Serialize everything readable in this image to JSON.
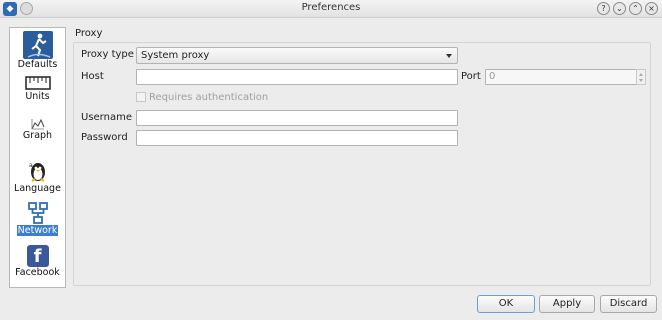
{
  "window": {
    "title": "Preferences",
    "controls": [
      "help-icon",
      "minimize-icon",
      "maximize-icon",
      "close-icon"
    ]
  },
  "sidebar": {
    "items": [
      {
        "label": "Defaults",
        "icon": "defaults-icon",
        "selected": false
      },
      {
        "label": "Units",
        "icon": "ruler-icon",
        "selected": false
      },
      {
        "label": "Graph",
        "icon": "graph-icon",
        "selected": false
      },
      {
        "label": "Language",
        "icon": "language-icon",
        "selected": false
      },
      {
        "label": "Network",
        "icon": "network-icon",
        "selected": true
      },
      {
        "label": "Facebook",
        "icon": "facebook-icon",
        "selected": false
      }
    ]
  },
  "proxy": {
    "section_title": "Proxy",
    "proxy_type_label": "Proxy type",
    "proxy_type_value": "System proxy",
    "host_label": "Host",
    "host_value": "",
    "port_label": "Port",
    "port_value": "0",
    "requires_auth_label": "Requires authentication",
    "requires_auth_checked": false,
    "username_label": "Username",
    "username_value": "",
    "password_label": "Password",
    "password_value": ""
  },
  "buttons": {
    "ok": "OK",
    "apply": "Apply",
    "discard": "Discard"
  },
  "colors": {
    "selection": "#3b7ed0",
    "facebook": "#3b5998",
    "defaults_icon": "#2b5c9c"
  }
}
